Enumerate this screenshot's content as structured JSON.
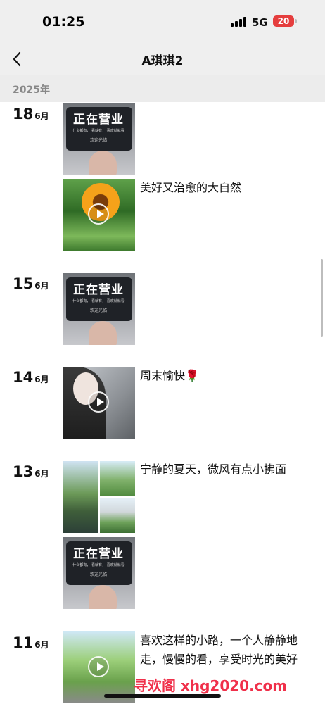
{
  "status": {
    "time": "01:25",
    "network": "5G",
    "battery": "20"
  },
  "nav": {
    "title": "A琪琪2"
  },
  "year": "2025年",
  "entries": [
    {
      "day": "18",
      "month": "6月",
      "caption": "美好又治愈的大自然"
    },
    {
      "day": "15",
      "month": "6月",
      "caption": ""
    },
    {
      "day": "14",
      "month": "6月",
      "caption": "周末愉快🌹"
    },
    {
      "day": "13",
      "month": "6月",
      "caption": "宁静的夏天，微风有点小拂面"
    },
    {
      "day": "11",
      "month": "6月",
      "caption": "喜欢这样的小路，一个人静静地走，慢慢的看，享受时光的美好"
    }
  ],
  "ad": {
    "title": "正在营业",
    "line1": "什么都有，   看就有，   喜欢就就看",
    "line2": "欢迎光临"
  },
  "watermark": "寻欢阁 xhg2020.com"
}
